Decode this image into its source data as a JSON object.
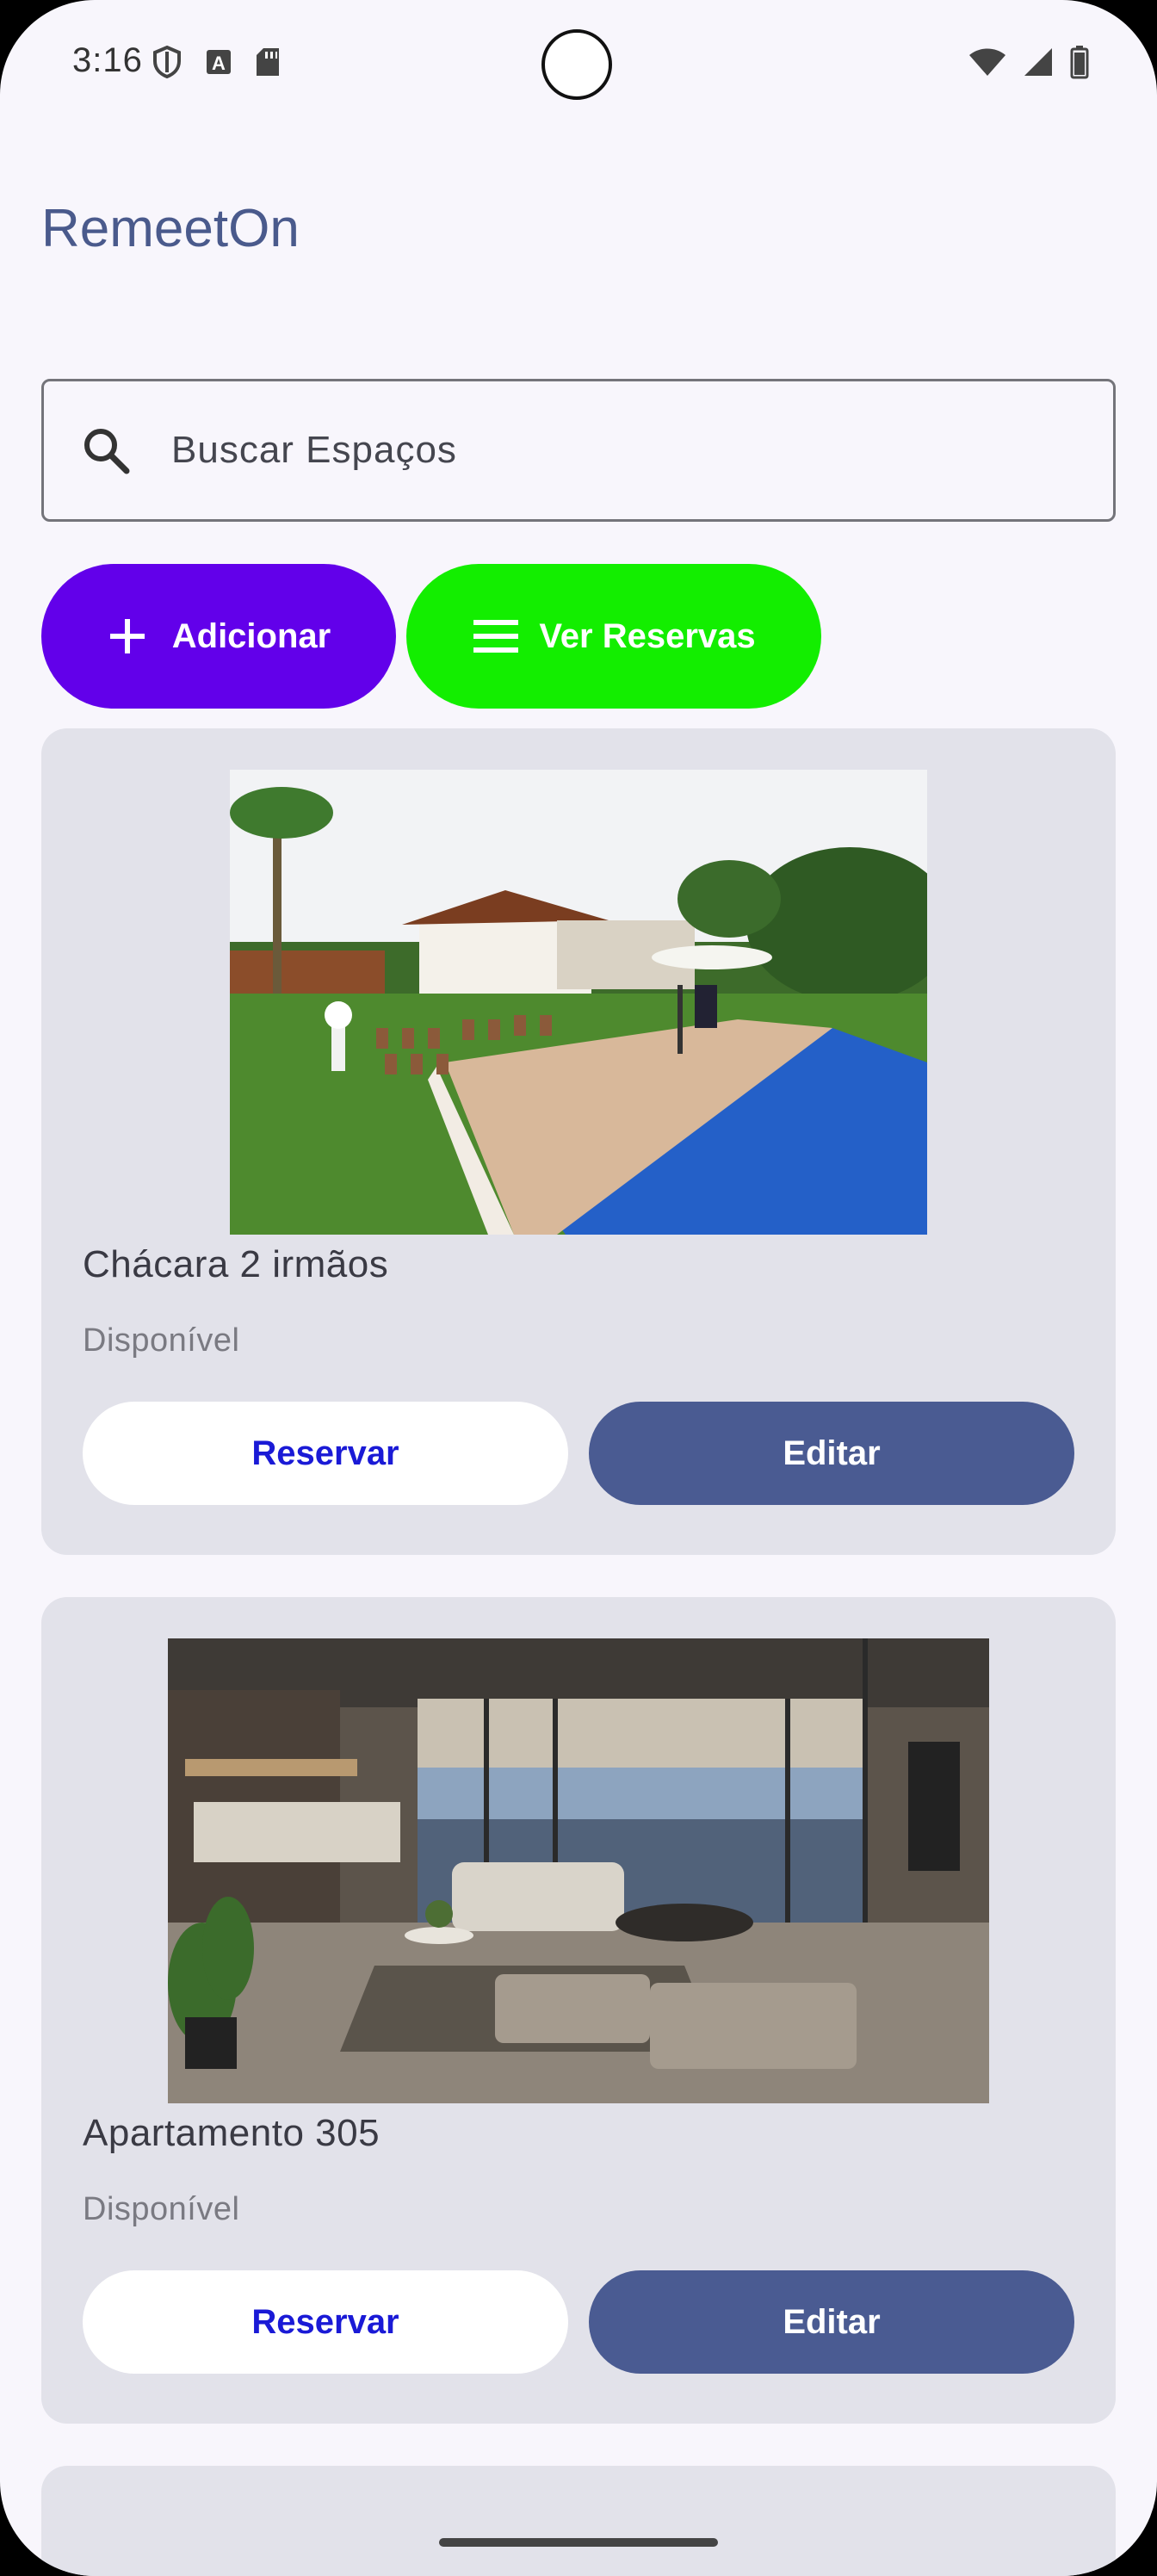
{
  "status_bar": {
    "time": "3:16",
    "left_icons": [
      "shield-icon",
      "font-a-icon",
      "sd-card-icon"
    ],
    "right_icons": [
      "wifi-icon",
      "cell-signal-icon",
      "battery-icon"
    ]
  },
  "app": {
    "title": "RemeetOn"
  },
  "search": {
    "placeholder": "Buscar Espaços",
    "icon": "search-icon"
  },
  "actions": {
    "add_label": "Adicionar",
    "add_color": "#6200ea",
    "reservations_label": "Ver Reservas",
    "reservations_color": "#13ee00"
  },
  "spaces": [
    {
      "name": "Chácara 2 irmãos",
      "status": "Disponível",
      "reserve_label": "Reservar",
      "edit_label": "Editar"
    },
    {
      "name": "Apartamento 305",
      "status": "Disponível",
      "reserve_label": "Reservar",
      "edit_label": "Editar"
    }
  ],
  "colors": {
    "title": "#4a5a8c",
    "card_bg": "#e2e2ea",
    "edit_bg": "#4a5b92",
    "reserve_text": "#1a1ad6"
  }
}
